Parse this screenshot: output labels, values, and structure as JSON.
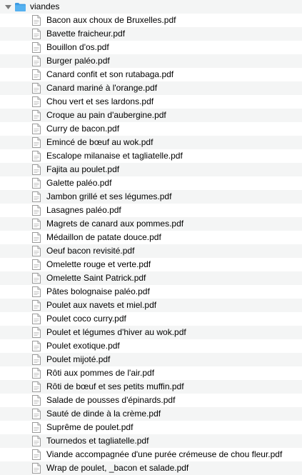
{
  "folder": {
    "name": "viandes",
    "expanded": true,
    "icon": "folder-icon"
  },
  "files": [
    "Bacon aux choux de Bruxelles.pdf",
    "Bavette fraicheur.pdf",
    "Bouillon d'os.pdf",
    "Burger paléo.pdf",
    "Canard confit et son rutabaga.pdf",
    "Canard mariné à l'orange.pdf",
    "Chou vert et ses lardons.pdf",
    "Croque au pain d'aubergine.pdf",
    "Curry de bacon.pdf",
    "Emincé de bœuf au wok.pdf",
    "Escalope milanaise et tagliatelle.pdf",
    "Fajita au poulet.pdf",
    "Galette paléo.pdf",
    "Jambon grillé et ses légumes.pdf",
    "Lasagnes paléo.pdf",
    "Magrets de canard aux pommes.pdf",
    "Médaillon de patate douce.pdf",
    "Oeuf bacon revisité.pdf",
    "Omelette rouge et verte.pdf",
    "Omelette Saint Patrick.pdf",
    "Pâtes bolognaise paléo.pdf",
    "Poulet aux navets et miel.pdf",
    "Poulet coco curry.pdf",
    "Poulet et légumes d'hiver au wok.pdf",
    "Poulet exotique.pdf",
    "Poulet mijoté.pdf",
    "Rôti aux pommes de l'air.pdf",
    "Rôti de bœuf et ses petits muffin.pdf",
    "Salade de pousses d'épinards.pdf",
    "Sauté de dinde à la crème.pdf",
    "Suprême de poulet.pdf",
    "Tournedos et tagliatelle.pdf",
    "Viande accompagnée d'une purée crémeuse de chou fleur.pdf",
    "Wrap de poulet, _bacon et salade.pdf"
  ],
  "colors": {
    "alt_row": "#f4f5f5",
    "folder_blue": "#55b1f0",
    "folder_blue_dark": "#3d9be3",
    "text": "#000000"
  }
}
